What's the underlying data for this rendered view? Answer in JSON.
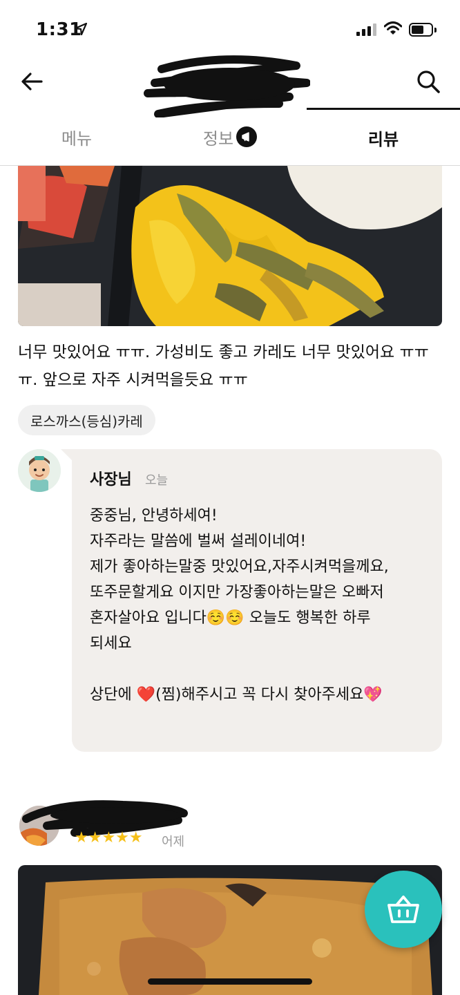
{
  "status_bar": {
    "time": "1:31"
  },
  "tabs": {
    "menu": "메뉴",
    "info": "정보",
    "review": "리뷰"
  },
  "review1": {
    "text": "너무 맛있어요 ㅠㅠ. 가성비도 좋고 카레도 너무 맛있어요 ㅠㅠㅠ. 앞으로 자주 시켜먹을듯요 ㅠㅠ",
    "menu_chip": "로스까스(등심)카레"
  },
  "owner_reply": {
    "name": "사장님",
    "time": "오늘",
    "body": "중중님, 안녕하세여!\n자주라는 말씀에 벌써 설레이네여!\n제가 좋아하는말중 맛있어요,자주시켜먹을께요,\n또주문할게요 이지만 가장좋아하는말은 오빠저\n혼자살아요 입니다☺️☺️  오늘도 행복한 하루\n되세요\n\n상단에 ❤️(찜)해주시고 꼭 다시 찾아주세요💖"
  },
  "review2": {
    "stars": "★★★★★",
    "rating": 5,
    "date": "어제"
  },
  "icons": {
    "back": "arrow-left-icon",
    "search": "search-icon",
    "info": "megaphone-icon",
    "cart": "basket-icon"
  },
  "colors": {
    "accent": "#2ac1bc",
    "star": "#f6c019",
    "bubble": "#f2efec"
  }
}
